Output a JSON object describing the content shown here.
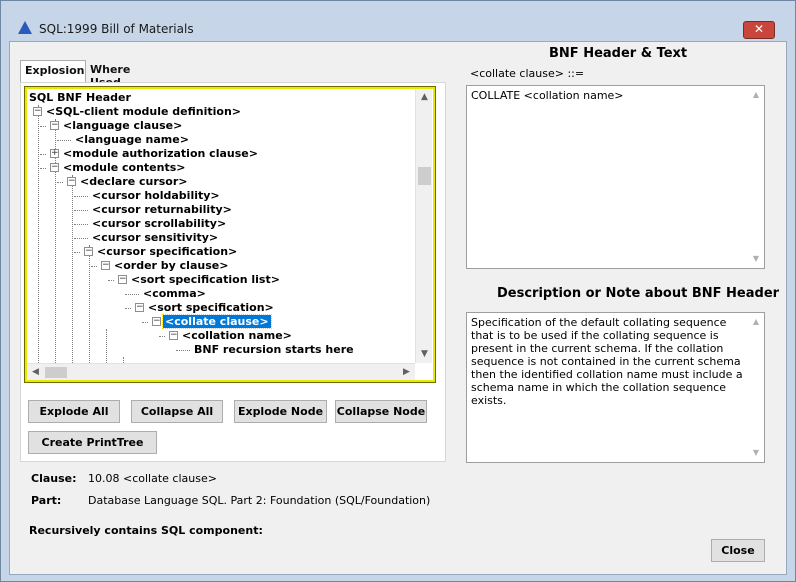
{
  "window": {
    "title": "SQL:1999 Bill of Materials",
    "close_glyph": "✕"
  },
  "tabs": [
    {
      "label": "Explosion",
      "active": true
    },
    {
      "label": "Where Used",
      "active": false
    }
  ],
  "tree": {
    "root": "SQL BNF Header",
    "nodes": [
      {
        "label": "<SQL-client module definition>",
        "expander": "−"
      },
      {
        "label": "<language clause>",
        "expander": "−"
      },
      {
        "label": "<language name>",
        "expander": ""
      },
      {
        "label": "<module authorization clause>",
        "expander": "+"
      },
      {
        "label": "<module contents>",
        "expander": "−"
      },
      {
        "label": "<declare cursor>",
        "expander": "−"
      },
      {
        "label": "<cursor holdability>",
        "expander": ""
      },
      {
        "label": "<cursor returnability>",
        "expander": ""
      },
      {
        "label": "<cursor scrollability>",
        "expander": ""
      },
      {
        "label": "<cursor sensitivity>",
        "expander": ""
      },
      {
        "label": "<cursor specification>",
        "expander": "−"
      },
      {
        "label": "<order by clause>",
        "expander": "−"
      },
      {
        "label": "<sort specification list>",
        "expander": "−"
      },
      {
        "label": "<comma>",
        "expander": ""
      },
      {
        "label": "<sort specification>",
        "expander": "−"
      },
      {
        "label": "<collate clause>",
        "expander": "−",
        "selected": true
      },
      {
        "label": "<collation name>",
        "expander": "−"
      },
      {
        "label": "BNF recursion starts here",
        "expander": ""
      }
    ]
  },
  "buttons": {
    "explode_all": "Explode All",
    "collapse_all": "Collapse All",
    "explode_node": "Explode Node",
    "collapse_node": "Collapse Node",
    "create_printtree": "Create PrintTree",
    "close": "Close"
  },
  "bnf": {
    "heading": "BNF Header & Text",
    "prefix": "<collate clause> ::=",
    "text": "COLLATE <collation name>"
  },
  "description": {
    "heading": "Description or Note about BNF Header",
    "text": "Specification of the default collating sequence that is to be used if the collating sequence is present in the current schema. If the collation sequence is not contained in the current schema then the identified collation name must include a schema name in which the collation sequence exists."
  },
  "info": {
    "clause_label": "Clause:",
    "clause_value": "10.08 <collate clause>",
    "part_label": "Part:",
    "part_value": "Database Language SQL. Part 2: Foundation (SQL/Foundation)",
    "recursive_label": "Recursively contains SQL component:"
  },
  "icons": {
    "scroll_up": "▲",
    "scroll_down": "▼",
    "scroll_left": "◀",
    "scroll_right": "▶"
  }
}
